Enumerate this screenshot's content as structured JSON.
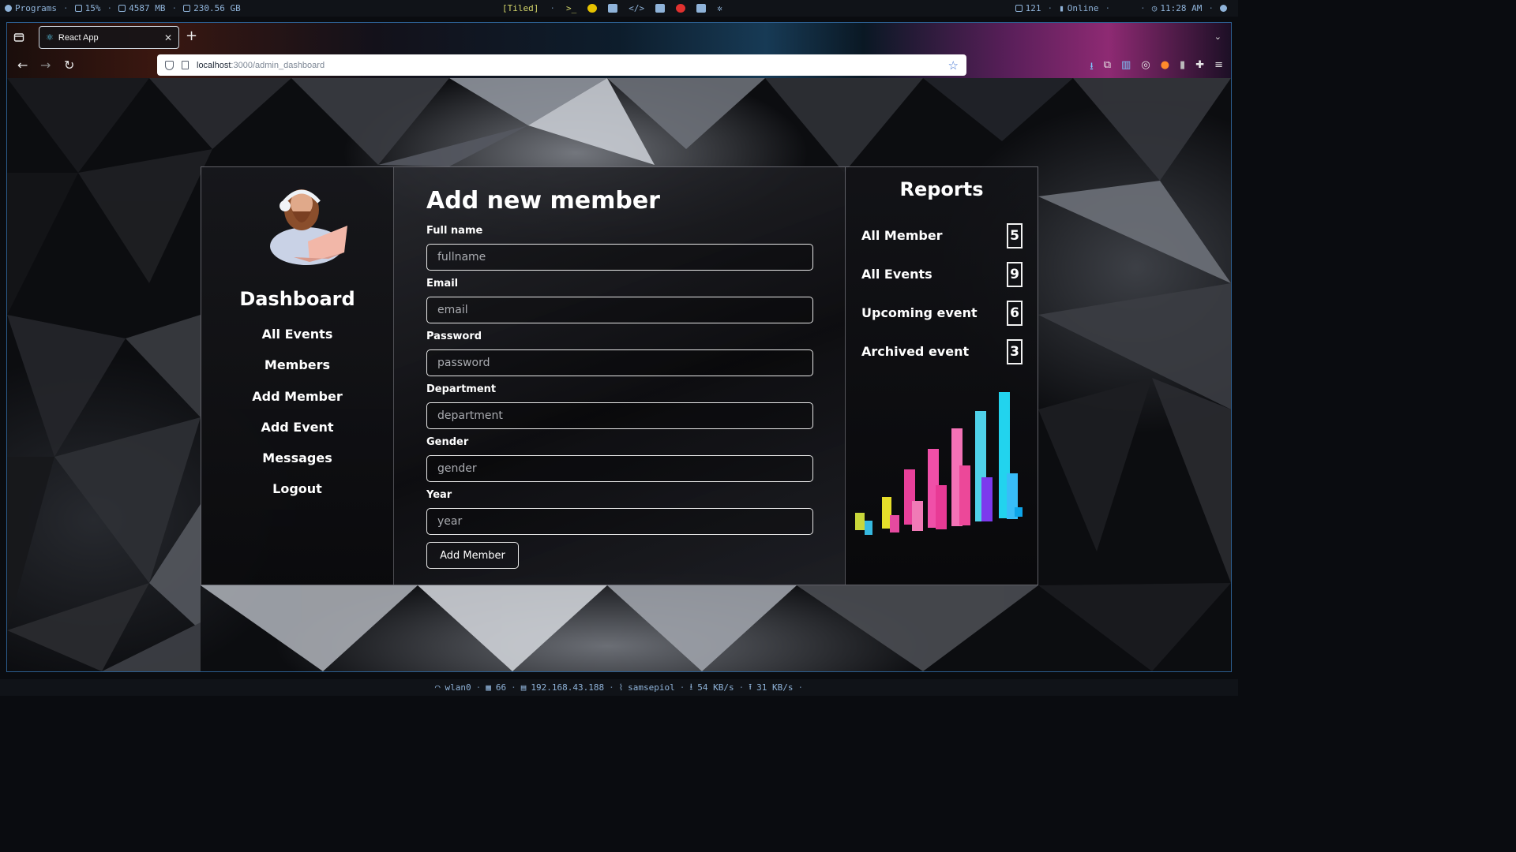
{
  "system_bar": {
    "programs": "Programs",
    "cpu": "15%",
    "memory": "4587 MB",
    "disk": "230.56 GB",
    "layout": "[Tiled]",
    "updates": "121",
    "network_status": "Online",
    "clock": "11:28 AM"
  },
  "browser": {
    "tab_title": "React App",
    "url_host": "localhost",
    "url_path": ":3000/admin_dashboard"
  },
  "sidebar": {
    "title": "Dashboard",
    "items": [
      {
        "label": "All Events"
      },
      {
        "label": "Members"
      },
      {
        "label": "Add Member"
      },
      {
        "label": "Add Event"
      },
      {
        "label": "Messages"
      },
      {
        "label": "Logout"
      }
    ]
  },
  "form": {
    "title": "Add new member",
    "fields": [
      {
        "label": "Full name",
        "placeholder": "fullname",
        "value": ""
      },
      {
        "label": "Email",
        "placeholder": "email",
        "value": ""
      },
      {
        "label": "Password",
        "placeholder": "password",
        "value": ""
      },
      {
        "label": "Department",
        "placeholder": "department",
        "value": ""
      },
      {
        "label": "Gender",
        "placeholder": "gender",
        "value": ""
      },
      {
        "label": "Year",
        "placeholder": "year",
        "value": ""
      }
    ],
    "submit_label": "Add Member"
  },
  "reports": {
    "title": "Reports",
    "items": [
      {
        "label": "All Member",
        "count": "5"
      },
      {
        "label": "All Events",
        "count": "9"
      },
      {
        "label": "Upcoming event",
        "count": "6"
      },
      {
        "label": "Archived event",
        "count": "3"
      }
    ]
  },
  "status_bar": {
    "interface": "wlan0",
    "signal": "66",
    "ip": "192.168.43.188",
    "ssid": "samsepiol",
    "down": "54 KB/s",
    "up": "31 KB/s"
  },
  "colors": {
    "accent_blue": "#8fb3d9",
    "react": "#61dafb"
  }
}
